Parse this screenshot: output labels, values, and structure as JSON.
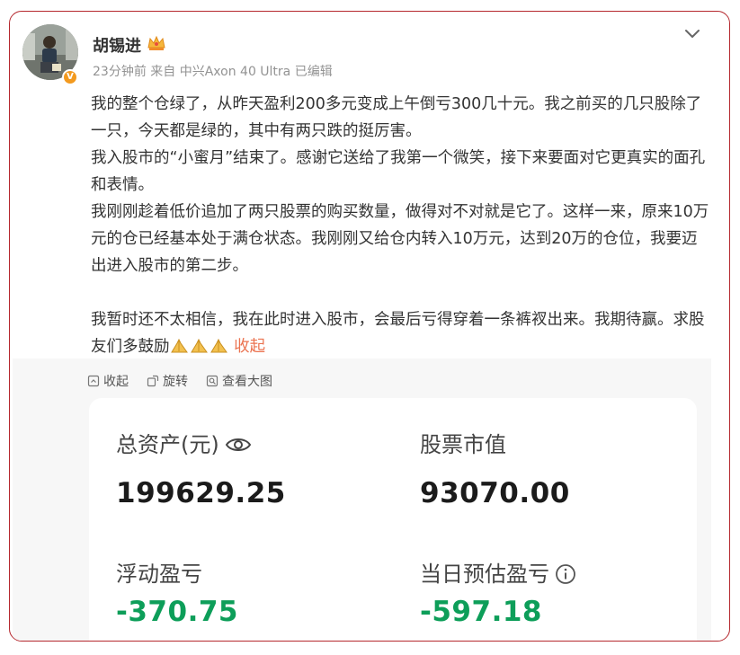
{
  "post": {
    "username": "胡锡进",
    "meta": "23分钟前 来自 中兴Axon 40 Ultra 已编辑",
    "paragraphs": [
      "我的整个仓绿了，从昨天盈利200多元变成上午倒亏300几十元。我之前买的几只股除了一只，今天都是绿的，其中有两只跌的挺厉害。",
      "我入股市的“小蜜月”结束了。感谢它送给了我第一个微笑，接下来要面对它更真实的面孔和表情。",
      "我刚刚趁着低价追加了两只股票的购买数量，做得对不对就是它了。这样一来，原来10万元的仓已经基本处于满仓状态。我刚刚又给仓内转入10万元，达到20万的仓位，我要迈出进入股市的第二步。",
      "我暂时还不太相信，我在此时进入股市，会最后亏得穿着一条裤衩出来。我期待赢。求股友们多鼓励"
    ],
    "collapse_label": "收起"
  },
  "toolbar": {
    "collapse": "收起",
    "rotate": "旋转",
    "view_large": "查看大图"
  },
  "account": {
    "total_assets_label": "总资产(元)",
    "total_assets_value": "199629.25",
    "market_value_label": "股票市值",
    "market_value_value": "93070.00",
    "floating_pl_label": "浮动盈亏",
    "floating_pl_value": "-370.75",
    "daily_pl_label": "当日预估盈亏",
    "daily_pl_value": "-597.18"
  },
  "colors": {
    "border": "#b5282e",
    "link": "#eb7350",
    "loss_green": "#0d9e59",
    "vip_badge": "#f39a1f"
  },
  "icons": [
    "crown-icon",
    "chevron-down-icon",
    "verified-badge-icon",
    "folded-hands-emoji",
    "collapse-icon",
    "rotate-icon",
    "view-large-icon",
    "eye-icon",
    "info-icon"
  ]
}
